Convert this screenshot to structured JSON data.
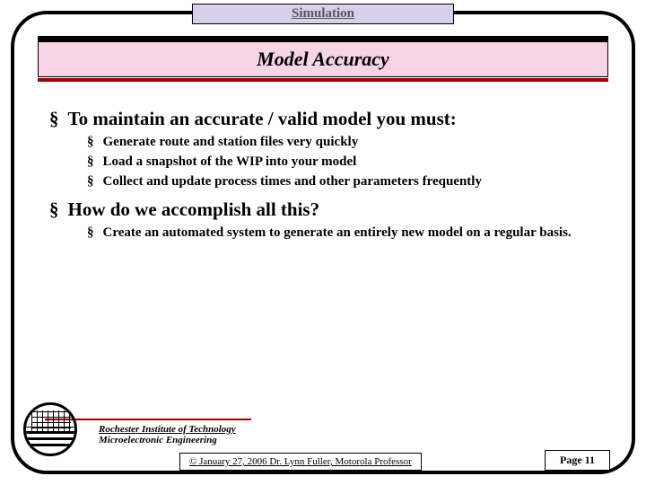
{
  "header": {
    "label": "Simulation"
  },
  "title": "Model Accuracy",
  "points": {
    "p1": "To maintain an accurate / valid model you must:",
    "p1a": "Generate route and station files very quickly",
    "p1b": "Load a snapshot of the WIP into your model",
    "p1c": "Collect and update process times and other parameters frequently",
    "p2": "How do we accomplish all this?",
    "p2a": "Create an automated system to generate an entirely new model on a regular basis."
  },
  "bullet": "§",
  "footer": {
    "institution": "Rochester Institute of Technology",
    "dept": "Microelectronic Engineering",
    "copyright": "© January 27, 2006  Dr. Lynn Fuller, Motorola Professor",
    "page": "Page 11"
  }
}
